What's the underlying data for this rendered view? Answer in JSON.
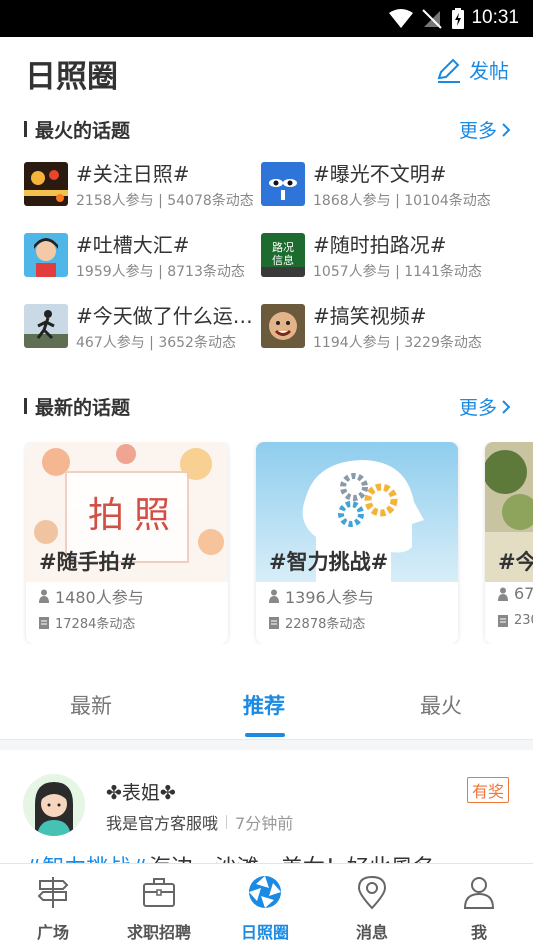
{
  "status_bar": {
    "time": "10:31"
  },
  "header": {
    "title": "日照圈",
    "post_label": "发帖"
  },
  "hot_section": {
    "title": "最火的话题",
    "more": "更多",
    "topics": [
      {
        "name": "#关注日照#",
        "stats": "2158人参与 | 54078条动态"
      },
      {
        "name": "#曝光不文明#",
        "stats": "1868人参与 | 10104条动态"
      },
      {
        "name": "#吐槽大汇#",
        "stats": "1959人参与 | 8713条动态"
      },
      {
        "name": "#随时拍路况#",
        "stats": "1057人参与 | 1141条动态"
      },
      {
        "name": "#今天做了什么运动#",
        "stats": "467人参与 | 3652条动态"
      },
      {
        "name": "#搞笑视频#",
        "stats": "1194人参与 | 3229条动态"
      }
    ],
    "thumb_text": {
      "road": "路况\n信息",
      "road_line1": "路况",
      "road_line2": "信息",
      "expose": "曝光不文明"
    }
  },
  "new_section": {
    "title": "最新的话题",
    "more": "更多",
    "cards": [
      {
        "title": "#随手拍#",
        "participants": "1480人参与",
        "posts": "17284条动态",
        "cover_text_1": "拍",
        "cover_text_2": "照"
      },
      {
        "title": "#智力挑战#",
        "participants": "1396人参与",
        "posts": "22878条动态"
      },
      {
        "title": "#今",
        "participants": "67",
        "posts": "230"
      }
    ]
  },
  "tabs": {
    "items": [
      "最新",
      "推荐",
      "最火"
    ],
    "active": "推荐"
  },
  "post": {
    "author": "✤表姐✤",
    "author_desc": "我是官方客服哦",
    "time": "7分钟前",
    "badge": "有奖",
    "text_tag": "#智力挑战#",
    "text_body": "海边，沙滩，美女！好此風名"
  },
  "bottom_nav": {
    "items": [
      {
        "label": "广场",
        "icon": "signpost-icon"
      },
      {
        "label": "求职招聘",
        "icon": "briefcase-icon"
      },
      {
        "label": "日照圈",
        "icon": "aperture-icon"
      },
      {
        "label": "消息",
        "icon": "location-pin-icon"
      },
      {
        "label": "我",
        "icon": "person-icon"
      }
    ],
    "active": "日照圈"
  },
  "colors": {
    "accent": "#1b8ae3",
    "badge": "#f2763a",
    "status_bar": "#000000"
  }
}
